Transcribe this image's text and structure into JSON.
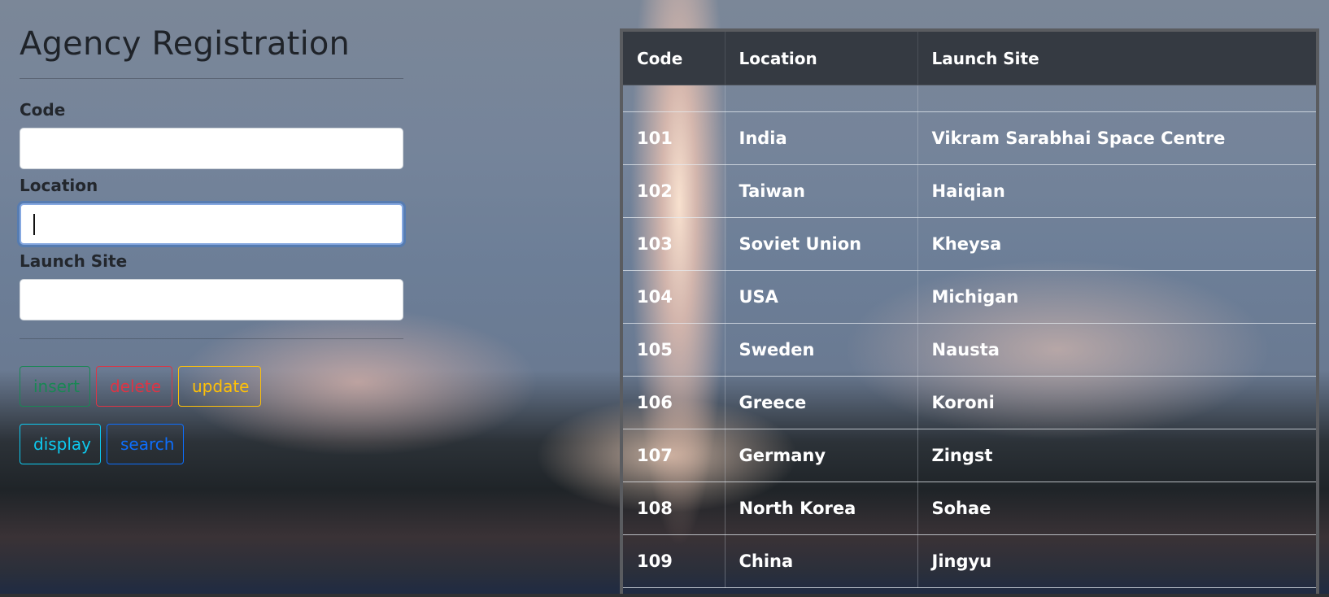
{
  "form": {
    "title": "Agency Registration",
    "fields": {
      "code_label": "Code",
      "code_value": "",
      "location_label": "Location",
      "location_value": "",
      "launch_site_label": "Launch Site",
      "launch_site_value": ""
    },
    "buttons": {
      "insert": "insert",
      "delete": "delete",
      "update": "update",
      "display": "display",
      "search": "search"
    }
  },
  "table": {
    "headers": [
      "Code",
      "Location",
      "Launch Site"
    ],
    "rows": [
      [
        "",
        "",
        ""
      ],
      [
        "101",
        "India",
        "Vikram Sarabhai Space Centre"
      ],
      [
        "102",
        "Taiwan",
        "Haiqian"
      ],
      [
        "103",
        "Soviet Union",
        "Kheysa"
      ],
      [
        "104",
        "USA",
        "Michigan"
      ],
      [
        "105",
        "Sweden",
        "Nausta"
      ],
      [
        "106",
        "Greece",
        "Koroni"
      ],
      [
        "107",
        "Germany",
        "Zingst"
      ],
      [
        "108",
        "North Korea",
        "Sohae"
      ],
      [
        "109",
        "China",
        "Jingyu"
      ]
    ]
  },
  "colors": {
    "insert": "#198754",
    "delete": "#dc3545",
    "update": "#ffc107",
    "display": "#0dcaf0",
    "search": "#0d6efd",
    "table_header_bg": "#353a42"
  }
}
